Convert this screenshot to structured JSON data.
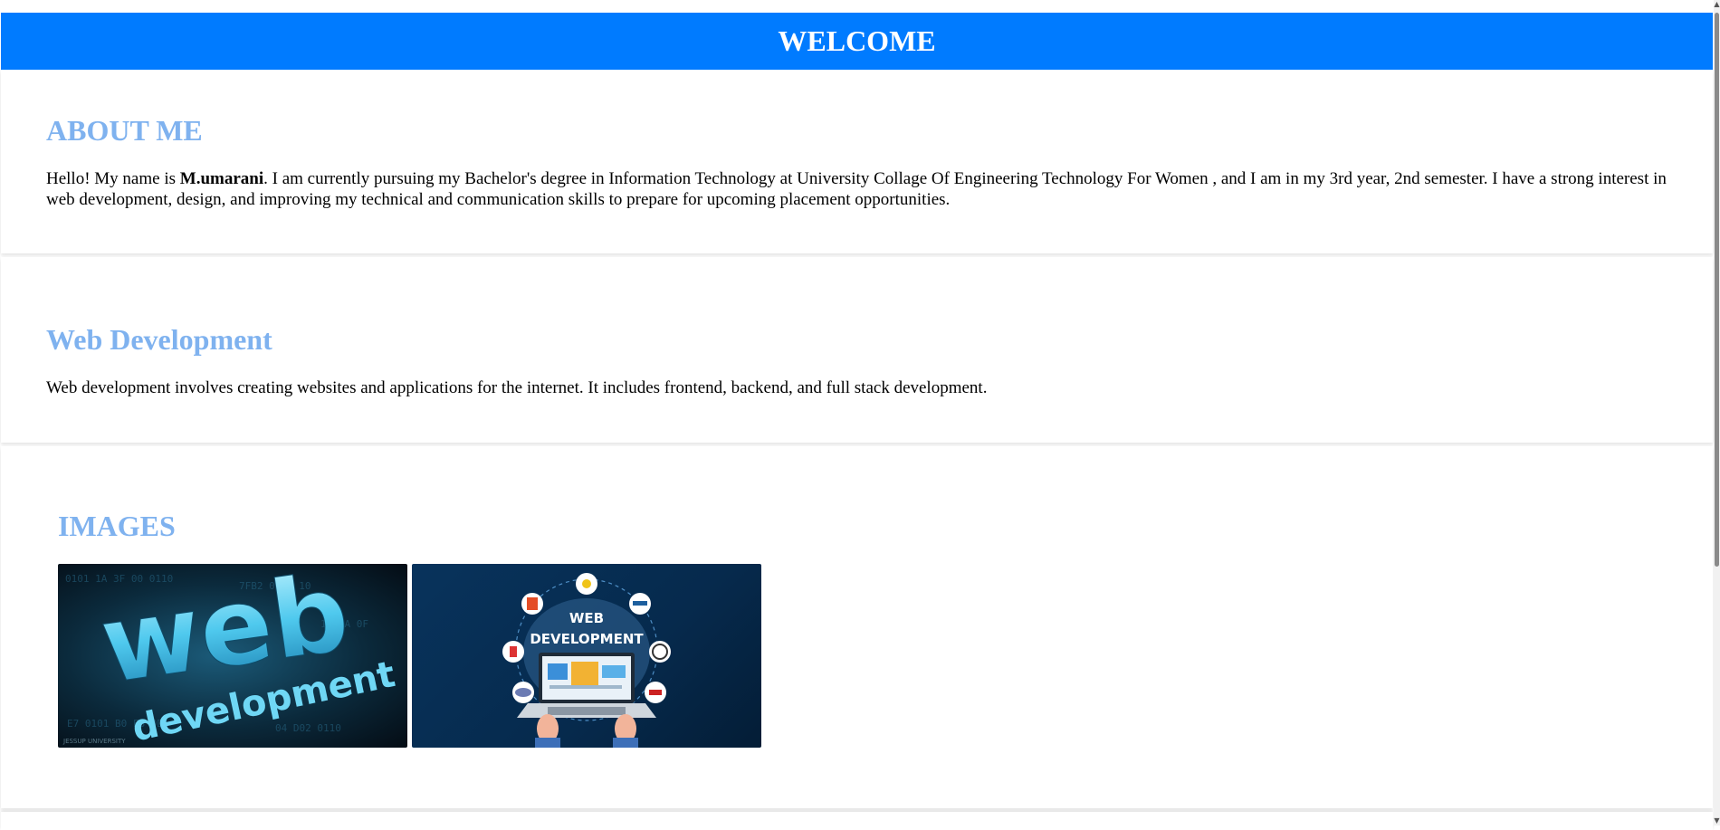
{
  "header": {
    "title": "WELCOME"
  },
  "about": {
    "heading": "ABOUT ME",
    "intro": "Hello! My name is ",
    "name": "M.umarani",
    "body": ". I am currently pursuing my Bachelor's degree in Information Technology at University Collage Of Engineering Technology For Women , and I am in my 3rd year, 2nd semester. I have a strong interest in web development, design, and improving my technical and communication skills to prepare for upcoming placement opportunities."
  },
  "web": {
    "heading": "Web Development",
    "body": "Web development involves creating websites and applications for the internet. It includes frontend, backend, and full stack development."
  },
  "images": {
    "heading": "IMAGES",
    "image1": {
      "word1": "web",
      "word2": "development",
      "watermark": "JESSUP UNIVERSITY"
    },
    "image2": {
      "title_line1": "WEB",
      "title_line2": "DEVELOPMENT"
    }
  },
  "colors": {
    "header_bg": "#007bff",
    "heading": "#7fb2ef"
  }
}
